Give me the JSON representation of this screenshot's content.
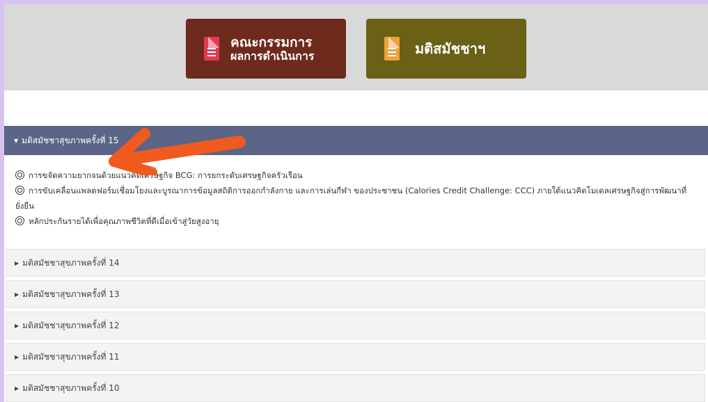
{
  "buttons": {
    "committee_line1": "คณะกรรมการ",
    "committee_line2": "ผลการดำเนินการ",
    "resolution": "มติสมัชชาฯ"
  },
  "expanded_section": {
    "title": "มติสมัชชาสุขภาพครั้งที่ 15",
    "items": [
      "การขจัดความยากจนด้วยแนวคิดเศรษฐกิจ BCG: การยกระดับเศรษฐกิจครัวเรือน",
      "การขับเคลื่อนแพลตฟอร์มเชื่อมโยงและบูรณาการข้อมูลสถิติการออกกำลังกาย และการเล่นกีฬา ของประชาชน (Calories Credit Challenge: CCC) ภายใต้แนวคิดโมเดลเศรษฐกิจสู่การพัฒนาที่ยั่งยืน",
      "หลักประกันรายได้เพื่อคุณภาพชีวิตที่ดีเมื่อเข้าสู่วัยสูงอายุ"
    ]
  },
  "collapsed_sections": [
    "มติสมัชชาสุขภาพครั้งที่ 14",
    "มติสมัชชาสุขภาพครั้งที่ 13",
    "มติสมัชชาสุขภาพครั้งที่ 12",
    "มติสมัชชาสุขภาพครั้งที่ 11",
    "มติสมัชชาสุขภาพครั้งที่ 10"
  ],
  "colors": {
    "background": "#d8c3f0",
    "header_band": "#d9d9d9",
    "committee_tile": "#6e2a1c",
    "resolution_tile": "#6a6016",
    "accordion_header": "#5a6587",
    "arrow": "#f05a1e"
  },
  "icons": {
    "tile_icon": "document-list-icon",
    "item_bullet": "link-circle-icon",
    "caret_down": "caret-down-icon",
    "caret_right": "caret-right-icon",
    "arrow": "arrow-left-icon"
  }
}
